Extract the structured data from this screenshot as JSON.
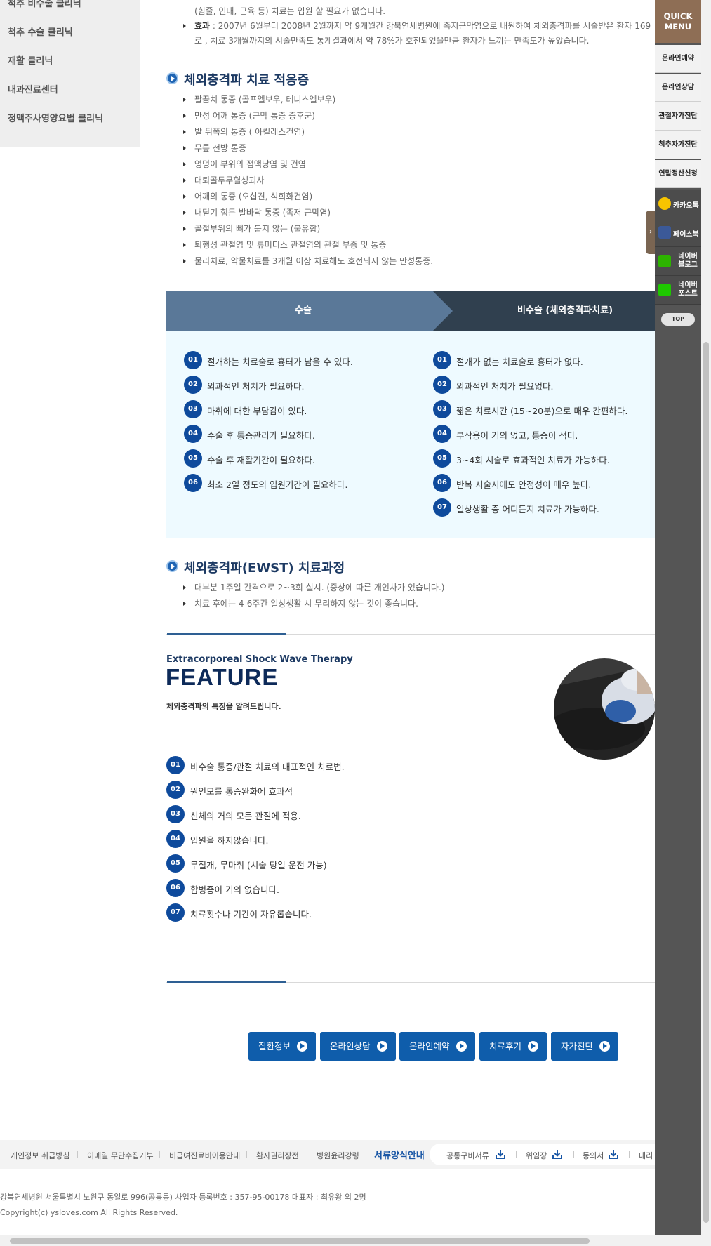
{
  "sidebar": {
    "items": [
      "척추 비수술 클리닉",
      "척추 수술 클리닉",
      "재활 클리닉",
      "내과진료센터",
      "정맥주사영양요법 클리닉"
    ]
  },
  "intro": {
    "line1": "(힘줄, 인대, 근육 등) 치료는 입원 할 필요가 없습니다.",
    "effect_label": "효과",
    "effect_line1": " : 2007년 6월부터 2008년 2월까지 약 9개월간 강북연세병원에 족저근막염으로 내원하여 체외충격파를 시술받은 환자 169",
    "effect_line2": "로 , 치료 3개월까지의 시술만족도 통계결과에서 약 78%가 호전되었을만큼 환자가 느끼는 만족도가 높았습니다."
  },
  "indications": {
    "title": "체외충격파 치료 적응증",
    "items": [
      "팔꿈치 통증 (골프엘보우, 테니스엘보우)",
      "만성 어깨 통증 (근막 통증 증후군)",
      "발 뒤쪽의 통증 ( 아킬레스건염)",
      "무릎 전방 통증",
      "엉덩이 부위의 점액낭염 및 건염",
      "대퇴골두무혈성괴사",
      "어깨의 통증 (오십견, 석회화건염)",
      "내딛기 힘든 발바닥 통증 (족저 근막염)",
      "골절부위의 뼈가 붙지 않는 (불유합)",
      "퇴행성 관절염 및 류머티스 관절염의 관절 부종 및 통증",
      "물리치료, 약물치료를 3개월 이상 치료해도 호전되지 않는 만성통증."
    ]
  },
  "comparison": {
    "left_title": "수술",
    "right_title": "비수술 (체외충격파치료)",
    "left_items": [
      {
        "num": "01",
        "text": "절개하는 치료술로 흉터가 남을 수 있다."
      },
      {
        "num": "02",
        "text": "외과적인 처치가 필요하다."
      },
      {
        "num": "03",
        "text": "마취에 대한 부담감이 있다."
      },
      {
        "num": "04",
        "text": "수술 후 통증관리가 필요하다."
      },
      {
        "num": "05",
        "text": "수술 후 재활기간이 필요하다."
      },
      {
        "num": "06",
        "text": "최소 2일 정도의 입원기간이 필요하다."
      }
    ],
    "right_items": [
      {
        "num": "01",
        "text": "절개가 없는 치료술로 흉터가 없다."
      },
      {
        "num": "02",
        "text": "외과적인 처치가 필요없다."
      },
      {
        "num": "03",
        "text": "짧은 치료시간 (15~20분)으로 매우 간편하다."
      },
      {
        "num": "04",
        "text": "부작용이 거의 없고, 통증이 적다."
      },
      {
        "num": "05",
        "text": "3~4회 시술로 효과적인 치료가 가능하다."
      },
      {
        "num": "06",
        "text": "반복 시술시에도 안정성이 매우 높다."
      },
      {
        "num": "07",
        "text": "일상생활 중 어디든지 치료가 가능하다."
      }
    ]
  },
  "process": {
    "title": "체외충격파(EWST) 치료과정",
    "items": [
      "대부분 1주일 간격으로 2~3회 실시. (증상에 따른 개인차가 있습니다.)",
      "치료 후에는 4-6주간 일상생활 시 무리하지 않는 것이 좋습니다."
    ]
  },
  "feature": {
    "subtitle": "Extracorporeal Shock Wave Therapy",
    "title": "FEATURE",
    "description": "체외충격파의 특징을 알려드립니다.",
    "items": [
      {
        "num": "01",
        "text": "비수술 통증/관절 치료의 대표적인 치료법."
      },
      {
        "num": "02",
        "text": "원인모를 통증완화에 효과적"
      },
      {
        "num": "03",
        "text": "신체의 거의 모든 관절에 적용."
      },
      {
        "num": "04",
        "text": "입원을 하지않습니다."
      },
      {
        "num": "05",
        "text": "무절개, 무마취 (시술 당일 운전 가능)"
      },
      {
        "num": "06",
        "text": "합병증이 거의 없습니다."
      },
      {
        "num": "07",
        "text": "치료횟수나 기간이 자유롭습니다."
      }
    ]
  },
  "buttons": [
    "질환정보",
    "온라인상담",
    "온라인예약",
    "치료후기",
    "자가진단"
  ],
  "footer": {
    "links": [
      "개인정보 취급방침",
      "이메일 무단수집거부",
      "비급여진료비이용안내",
      "환자권리장전",
      "병원윤리강령"
    ],
    "forms_title": "서류양식안내",
    "forms": [
      "공통구비서류",
      "위임장",
      "동의서",
      "대리"
    ],
    "address": "강북연세병원 서울특별시 노원구 동일로 996(공릉동) 사업자 등록번호 : 357-95-00178 대표자 : 최유왕 외 2명",
    "copyright": "Copyright(c) ysloves.com All Rights Reserved."
  },
  "quick_menu": {
    "title_line1": "QUICK",
    "title_line2": "MENU",
    "items": [
      "온라인예약",
      "온라인상담",
      "관절자가진단",
      "척추자가진단",
      "연말정산신청"
    ],
    "sns": [
      {
        "label": "카카오톡",
        "icon": "kakaotalk-icon",
        "color": "#f7c400"
      },
      {
        "label": "페이스북",
        "icon": "facebook-icon",
        "color": "#3b5998"
      },
      {
        "label": "네이버 블로그",
        "line1": "네이버",
        "line2": "블로그",
        "icon": "naver-blog-icon",
        "color": "#2db400"
      },
      {
        "label": "네이버 포스트",
        "line1": "네이버",
        "line2": "포스트",
        "icon": "naver-post-icon",
        "color": "#1ec800"
      }
    ],
    "toggle": "›",
    "top_label": "TOP"
  },
  "colors": {
    "brand_navy": "#1d3a63",
    "accent_blue": "#0f5dab",
    "number_badge": "#0e4a9c",
    "quick_brown": "#8e6e55"
  }
}
